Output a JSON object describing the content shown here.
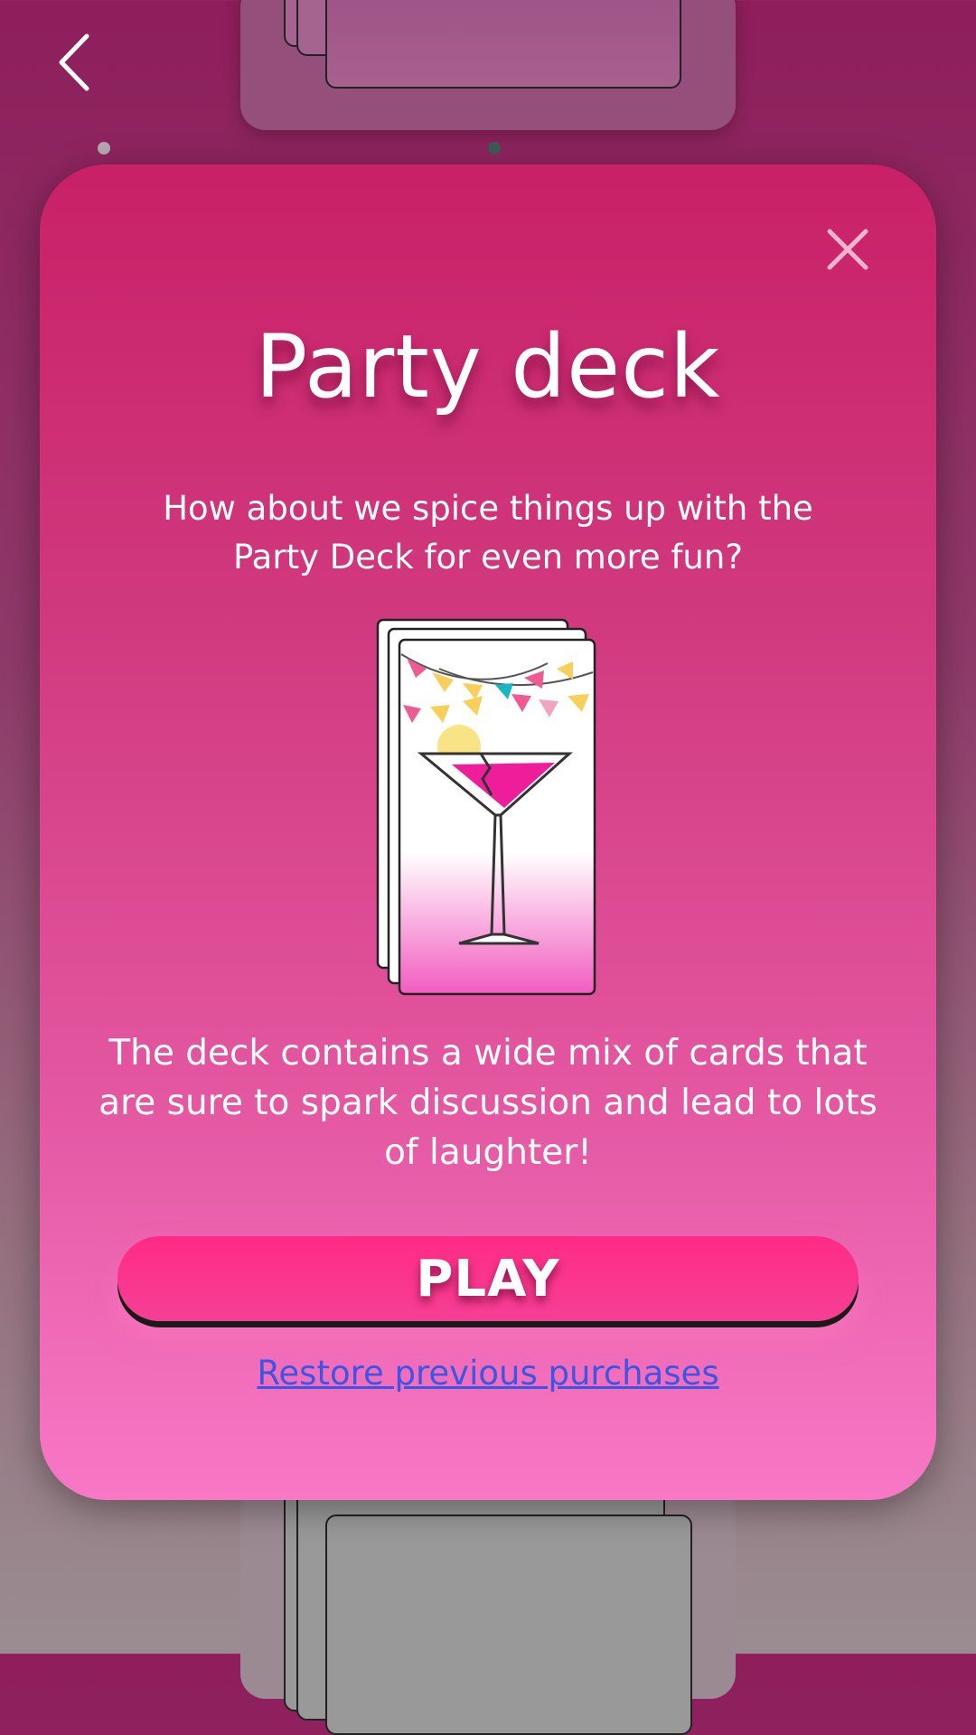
{
  "colors": {
    "modal_top": "#c92067",
    "modal_bottom": "#f878c6",
    "play_button": "#ff2b86",
    "link": "#3b56e6",
    "text": "#ffffff"
  },
  "nav": {
    "back_icon": "chevron-left-icon"
  },
  "modal": {
    "title": "Party deck",
    "subtitle": "How about we spice things up with the Party Deck for even more fun?",
    "description": "The deck contains a wide mix of cards that are sure to spark discussion and lead to lots of laughter!",
    "play_label": "PLAY",
    "restore_label": "Restore previous purchases",
    "close_icon": "close-icon",
    "illustration_icon": "cocktail-card-icon"
  }
}
